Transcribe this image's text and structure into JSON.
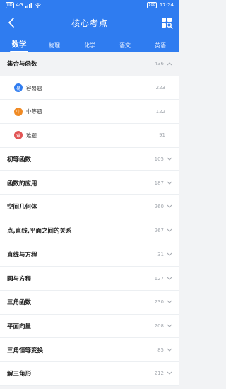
{
  "colors": {
    "header_bg": "#2f7cf0",
    "easy_badge": "#2f7cf0",
    "medium_badge": "#f08a24",
    "hard_badge": "#e25555"
  },
  "status": {
    "carrier": "HD",
    "net": "4G",
    "time": "17:24",
    "battery": "100"
  },
  "header": {
    "title": "核心考点",
    "back_icon": "chevron-left-icon",
    "menu_icon": "grid-search-icon"
  },
  "tabs": [
    {
      "label": "数学",
      "active": true
    },
    {
      "label": "物理",
      "active": false
    },
    {
      "label": "化学",
      "active": false
    },
    {
      "label": "语文",
      "active": false
    },
    {
      "label": "英语",
      "active": false
    }
  ],
  "expanded": {
    "label": "集合与函数",
    "count": "436"
  },
  "subitems": [
    {
      "badge": "易",
      "label": "容易题",
      "count": "223"
    },
    {
      "badge": "中",
      "label": "中等题",
      "count": "122"
    },
    {
      "badge": "难",
      "label": "难题",
      "count": "91"
    }
  ],
  "topics": [
    {
      "label": "初等函数",
      "count": "105"
    },
    {
      "label": "函数的应用",
      "count": "187"
    },
    {
      "label": "空间几何体",
      "count": "260"
    },
    {
      "label": "点,直线,平面之间的关系",
      "count": "267"
    },
    {
      "label": "直线与方程",
      "count": "31"
    },
    {
      "label": "圆与方程",
      "count": "127"
    },
    {
      "label": "三角函数",
      "count": "230"
    },
    {
      "label": "平面向量",
      "count": "208"
    },
    {
      "label": "三角恒等变换",
      "count": "85"
    },
    {
      "label": "解三角形",
      "count": "212"
    }
  ]
}
